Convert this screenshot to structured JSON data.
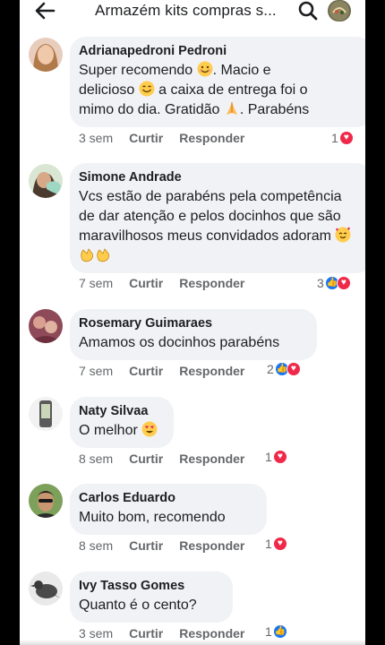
{
  "header": {
    "title": "Armazém kits compras s...",
    "back_icon": "arrow-left-icon",
    "search_icon": "search-icon"
  },
  "comments": [
    {
      "name": "Adrianapedroni Pedroni",
      "text_parts": [
        "Super recomendo ",
        "smile-emoji",
        ". Macio e delicioso ",
        "smile-emoji",
        " a caixa de entrega foi o mimo do dia. Gratidão ",
        "pray-emoji",
        ". Parabéns"
      ],
      "time": "3 sem",
      "like_label": "Curtir",
      "reply_label": "Responder",
      "reaction_count": "1",
      "reactions": [
        "love"
      ]
    },
    {
      "name": "Simone Andrade",
      "text": "Vcs estão de parabéns pela competência de dar atenção e pelos docinhos que são maravilhosos meus convidados adoram",
      "text_emojis": [
        "hearts-face-emoji",
        "clap-emoji",
        "clap-emoji"
      ],
      "time": "7 sem",
      "like_label": "Curtir",
      "reply_label": "Responder",
      "reaction_count": "3",
      "reactions": [
        "like",
        "love"
      ]
    },
    {
      "name": "Rosemary Guimaraes",
      "text": "Amamos os docinhos parabéns",
      "time": "7 sem",
      "like_label": "Curtir",
      "reply_label": "Responder",
      "reaction_count": "2",
      "reactions": [
        "like",
        "love"
      ]
    },
    {
      "name": "Naty Silvaa",
      "text": "O melhor",
      "text_emojis": [
        "heart-eyes-emoji"
      ],
      "time": "8 sem",
      "like_label": "Curtir",
      "reply_label": "Responder",
      "reaction_count": "1",
      "reactions": [
        "love"
      ]
    },
    {
      "name": "Carlos Eduardo",
      "text": "Muito bom, recomendo",
      "time": "8 sem",
      "like_label": "Curtir",
      "reply_label": "Responder",
      "reaction_count": "1",
      "reactions": [
        "love"
      ]
    },
    {
      "name": "Ivy Tasso Gomes",
      "text": "Quanto é o cento?",
      "time": "3 sem",
      "like_label": "Curtir",
      "reply_label": "Responder",
      "reaction_count": "1",
      "reactions": [
        "like"
      ]
    }
  ],
  "colors": {
    "bubble": "#f0f2f5",
    "love": "#f02849",
    "like": "#1877f2",
    "meta_text": "#65676b"
  }
}
